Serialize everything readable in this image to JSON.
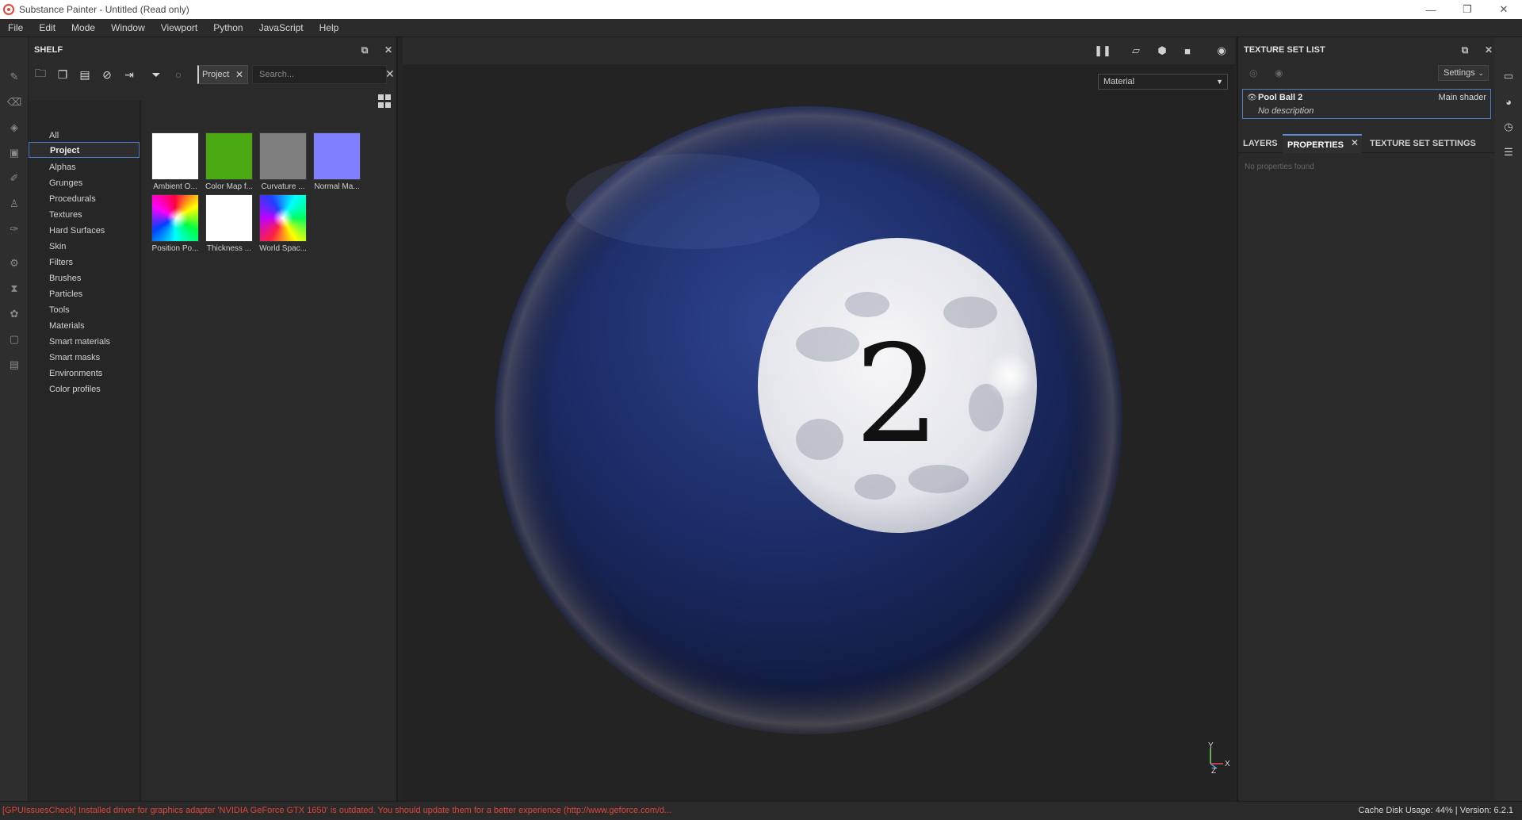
{
  "window": {
    "title": "Substance Painter - Untitled (Read only)"
  },
  "menu": [
    "File",
    "Edit",
    "Mode",
    "Window",
    "Viewport",
    "Python",
    "JavaScript",
    "Help"
  ],
  "shelf": {
    "title": "SHELF",
    "filter_chip": "Project",
    "search_placeholder": "Search...",
    "categories": [
      "All",
      "Project",
      "Alphas",
      "Grunges",
      "Procedurals",
      "Textures",
      "Hard Surfaces",
      "Skin",
      "Filters",
      "Brushes",
      "Particles",
      "Tools",
      "Materials",
      "Smart materials",
      "Smart masks",
      "Environments",
      "Color profiles"
    ],
    "selected_category": "Project",
    "assets": [
      {
        "label": "Ambient O...",
        "color": "#ffffff"
      },
      {
        "label": "Color Map f...",
        "color": "#4aa813"
      },
      {
        "label": "Curvature ...",
        "color": "#7f7f7f"
      },
      {
        "label": "Normal Ma...",
        "color": "#7f7fff"
      },
      {
        "label": "Position Po...",
        "color": "gradient"
      },
      {
        "label": "Thickness ...",
        "color": "#ffffff"
      },
      {
        "label": "World Spac...",
        "color": "gradient"
      }
    ]
  },
  "viewport": {
    "channel": "Material",
    "ball_number": "2",
    "ball_color": "#1b2a63",
    "axis": {
      "y": "Y",
      "x": "X",
      "z": "Z"
    }
  },
  "texture_set_list": {
    "title": "TEXTURE SET LIST",
    "settings_label": "Settings",
    "item": {
      "name": "Pool Ball 2",
      "shader": "Main shader",
      "description": "No description"
    }
  },
  "tabs": [
    "LAYERS",
    "PROPERTIES",
    "TEXTURE SET SETTINGS"
  ],
  "active_tab": "PROPERTIES",
  "properties_empty": "No properties found",
  "status": {
    "message": "[GPUIssuesCheck] Installed driver for graphics adapter 'NVIDIA GeForce GTX 1650' is outdated. You should update them for a better experience (http://www.geforce.com/d...",
    "cache": "Cache Disk Usage:    44% | Version: 6.2.1"
  },
  "colors": {
    "accent": "#4b7fd0",
    "error": "#e0453b"
  }
}
